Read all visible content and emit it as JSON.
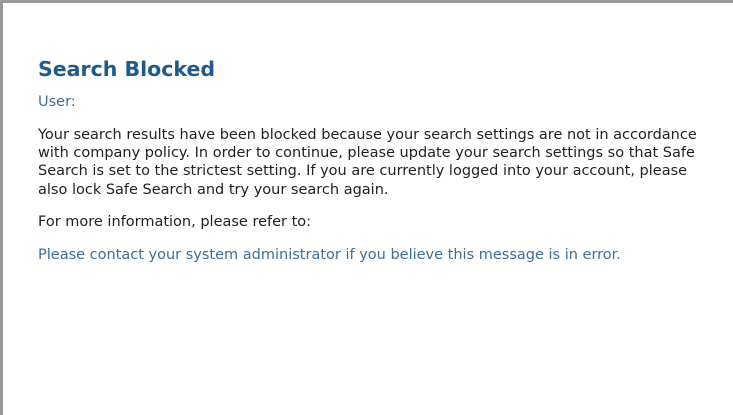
{
  "page": {
    "title": "Search Blocked",
    "user_label": "User:",
    "message": "Your search results have been blocked because your search settings are not in accordance with company policy. In order to continue, please update your search settings so that Safe Search is set to the strictest setting. If you are currently logged into your account, please also lock Safe Search and try your search again.",
    "more_info": "For more information, please refer to:",
    "contact": "Please contact your system administrator if you believe this message is in error."
  },
  "colors": {
    "title": "#1f5a8c",
    "accent_text": "#3d6e9a",
    "body_text": "#222222",
    "frame_border": "#9a9a9a",
    "background": "#ffffff"
  }
}
